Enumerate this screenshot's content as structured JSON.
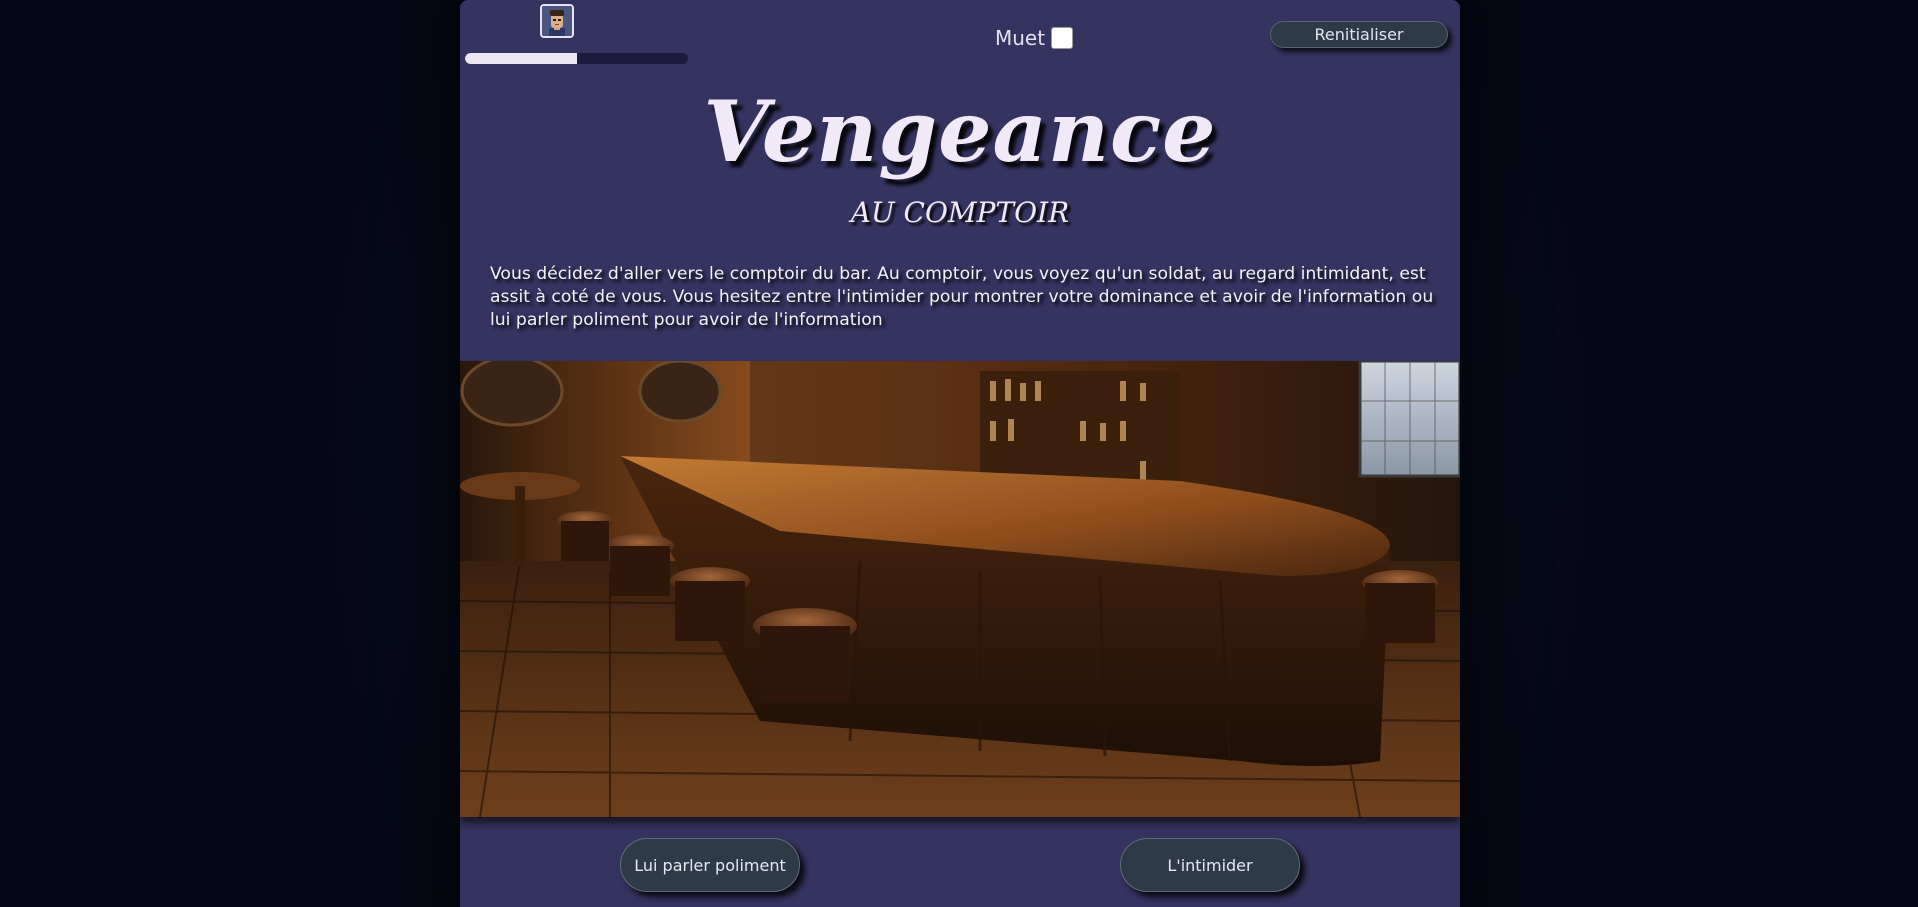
{
  "hud": {
    "avatar_icon": "soldier-portrait-icon",
    "progress": 0.5,
    "mute_label": "Muet",
    "mute_checked": false,
    "reset_label": "Renitialiser"
  },
  "story": {
    "title": "Vengeance",
    "scene_title": "AU COMPTOIR",
    "text": "Vous décidez d'aller vers le comptoir du bar. Au comptoir, vous voyez qu'un soldat, au regard intimidant, est assit à coté de vous. Vous hesitez entre l'intimider pour montrer votre dominance et avoir de l'information ou lui parler poliment pour avoir de l'information",
    "scene_image": "tavern-bar-counter-illustration"
  },
  "choices": [
    {
      "label": "Lui parler poliment"
    },
    {
      "label": "L'intimider"
    }
  ],
  "colors": {
    "page_background": "#060a18",
    "panel": "#35335f",
    "button": "#2e3b46",
    "title_text": "#f1e9f7"
  }
}
